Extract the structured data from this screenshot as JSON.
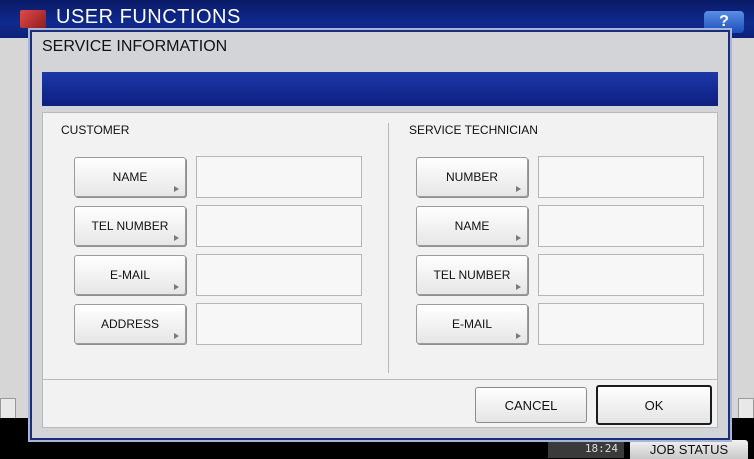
{
  "app": {
    "title": "USER FUNCTIONS",
    "help_label": "?",
    "time": "18:24",
    "job_status_label": "JOB STATUS"
  },
  "dialog": {
    "title": "SERVICE INFORMATION",
    "customer": {
      "heading": "CUSTOMER",
      "fields": [
        {
          "label": "NAME",
          "value": ""
        },
        {
          "label": "TEL NUMBER",
          "value": ""
        },
        {
          "label": "E-MAIL",
          "value": ""
        },
        {
          "label": "ADDRESS",
          "value": ""
        }
      ]
    },
    "technician": {
      "heading": "SERVICE TECHNICIAN",
      "fields": [
        {
          "label": "NUMBER",
          "value": ""
        },
        {
          "label": "NAME",
          "value": ""
        },
        {
          "label": "TEL NUMBER",
          "value": ""
        },
        {
          "label": "E-MAIL",
          "value": ""
        }
      ]
    },
    "cancel_label": "CANCEL",
    "ok_label": "OK"
  }
}
